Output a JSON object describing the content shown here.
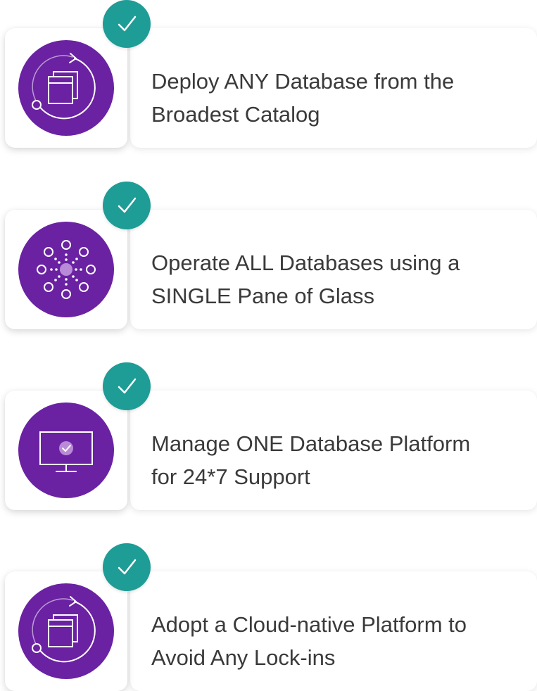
{
  "features": [
    {
      "text": "Deploy ANY Database from the\nBroadest Catalog",
      "icon": "deploy-cycle-icon"
    },
    {
      "text": "Operate ALL Databases using a\nSINGLE Pane of Glass",
      "icon": "hub-network-icon"
    },
    {
      "text": "Manage ONE Database Platform\nfor 24*7 Support",
      "icon": "monitor-check-icon"
    },
    {
      "text": "Adopt a Cloud-native Platform to\nAvoid Any Lock-ins",
      "icon": "deploy-cycle-icon"
    }
  ],
  "colors": {
    "icon_background": "#6a22a2",
    "check_badge": "#1e9c96",
    "text": "#3a3a3a"
  },
  "badge_icon": "checkmark-icon"
}
